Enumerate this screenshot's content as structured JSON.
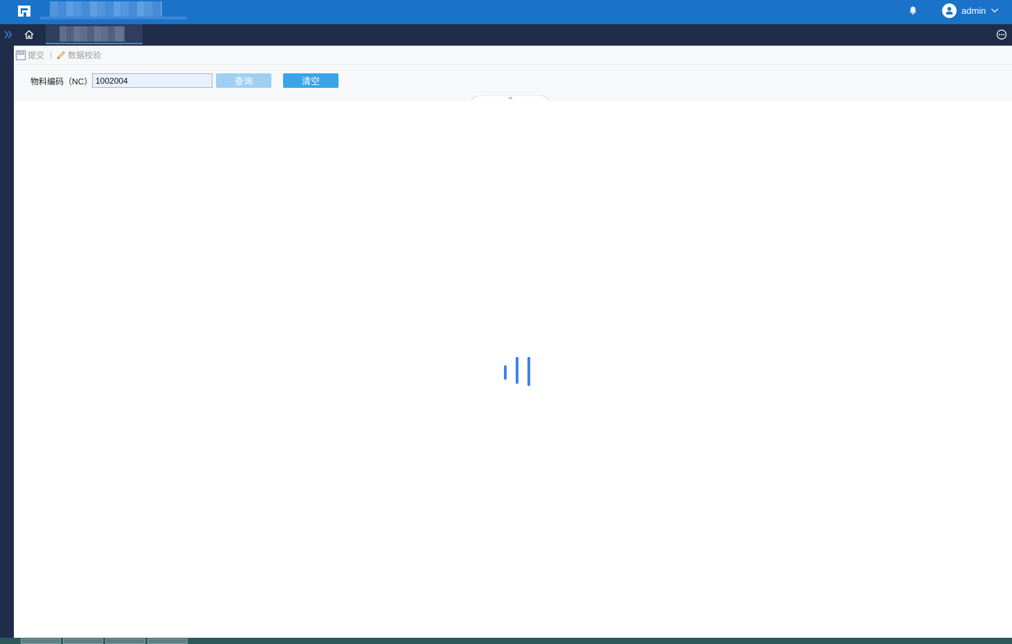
{
  "header": {
    "user_name": "admin"
  },
  "toolbar": {
    "submit_label": "提交",
    "validate_label": "数据校验"
  },
  "query": {
    "field_label": "物料编码（NC）",
    "field_value": "1002004",
    "query_button": "查询",
    "clear_button": "清空"
  },
  "colors": {
    "header_blue": "#1a73c9",
    "nav_dark": "#1f2d4a",
    "button_blue": "#3aa4e8",
    "button_disabled": "#9fd0f3",
    "loader_blue": "#3b82f0"
  },
  "icons": {
    "logo": "app-logo-icon",
    "bell": "bell-icon",
    "avatar": "user-avatar-icon",
    "chevron": "chevron-down-icon",
    "expand": "double-chevron-right-icon",
    "home": "home-icon",
    "more": "more-circle-icon",
    "save": "save-icon",
    "validate": "pencil-icon",
    "loader": "loading-spinner-icon"
  }
}
